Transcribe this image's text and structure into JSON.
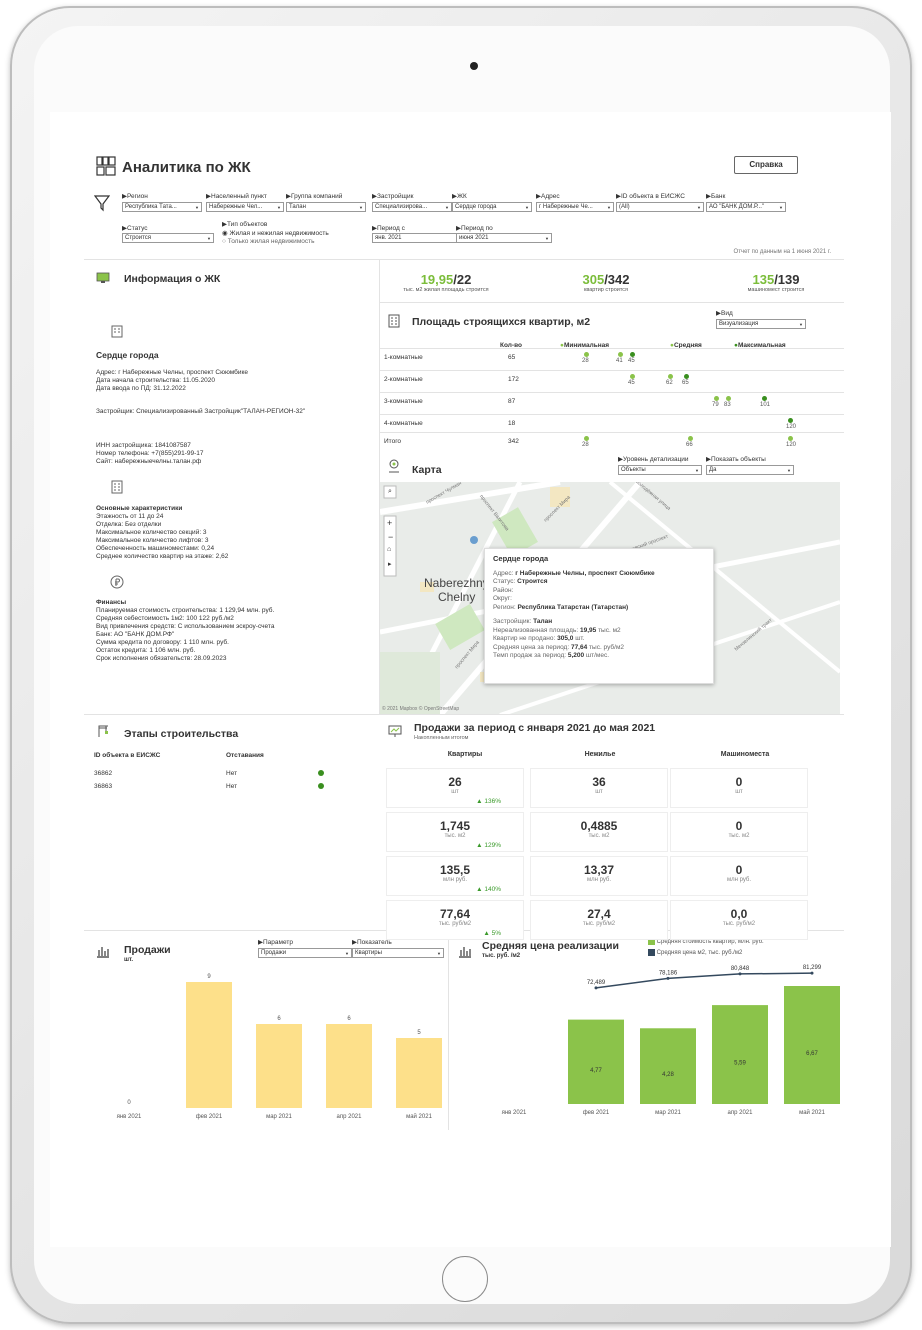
{
  "header": {
    "title": "Аналитика по ЖК",
    "help": "Справка",
    "report_date": "Отчет по данным на 1 июня 2021 г."
  },
  "filters": [
    {
      "label": "Регион",
      "value": "Республика Тата..."
    },
    {
      "label": "Населенный пункт",
      "value": "Набережные Чел..."
    },
    {
      "label": "Группа компаний",
      "value": "Талан"
    },
    {
      "label": "Застройщик",
      "value": "Специализирова..."
    },
    {
      "label": "ЖК",
      "value": "Сердце города"
    },
    {
      "label": "Адрес",
      "value": "г Набережные Че..."
    },
    {
      "label": "ID объекта в ЕИСЖС",
      "value": "(All)"
    },
    {
      "label": "Банк",
      "value": "АО \"БАНК ДОМ.Р...\""
    }
  ],
  "filters2": {
    "status_label": "Статус",
    "status_value": "Строится",
    "type_label": "Тип объектов",
    "type_opt1": "Жилая и нежилая недвижимость",
    "type_opt2": "Только жилая недвижимость",
    "from_label": "Период с",
    "from_value": "янв. 2021",
    "to_label": "Период по",
    "to_value": "июня 2021"
  },
  "info": {
    "title": "Информация о ЖК",
    "name": "Сердце города",
    "lines1": [
      "Адрес: г Набережные Челны, проспект Сююмбике",
      "Дата начала строительства: 11.05.2020",
      "Дата ввода по ПД: 31.12.2022"
    ],
    "developer": "Застройщик: Специализированный Застройщик\"ТАЛАН-РЕГИОН-32\"",
    "lines2": [
      "ИНН застройщика: 1841087587",
      "Номер телефона: +7(855)291-99-17",
      "Сайт: набережныечелны.талан.рф"
    ],
    "main_title": "Основные характеристики",
    "lines3": [
      "Этажность от 11 до 24",
      "Отделка: Без отделки",
      "Максимальное количество секций: 3",
      "Максимальное количество лифтов: 3",
      "Обеспеченность машиноместами: 0,24",
      "Среднее количество квартир на этаже: 2,62"
    ],
    "fin_title": "Финансы",
    "lines4": [
      "Планируемая стоимость строительства: 1 129,94 млн. руб.",
      "Средняя себестоимость 1м2: 100 122 руб./м2",
      "Вид привлечения средств: С использованием эскроу-счета",
      "Банк: АО \"БАНК ДОМ.РФ\"",
      "Сумма кредита по договору: 1 110 млн. руб.",
      "Остаток кредита: 1 106 млн. руб.",
      "Срок исполнения обязательств: 28.09.2023"
    ]
  },
  "kpis": [
    {
      "a": "19,95",
      "b": "/22",
      "sub": "тыс. м2 жилая площадь строится"
    },
    {
      "a": "305",
      "b": "/342",
      "sub": "квартир строится"
    },
    {
      "a": "135",
      "b": "/139",
      "sub": "машиномест строится"
    }
  ],
  "area": {
    "title": "Площадь строящихся квартир, м2",
    "view_label": "Вид",
    "view_value": "Визуализация",
    "cols": [
      "Кол-во",
      "Минимальная",
      "Средняя",
      "Максимальная"
    ],
    "rows": [
      {
        "name": "1-комнатные",
        "count": "65",
        "labels": [
          "28",
          "41",
          "45"
        ]
      },
      {
        "name": "2-комнатные",
        "count": "172",
        "labels": [
          "45",
          "62",
          "65"
        ]
      },
      {
        "name": "3-комнатные",
        "count": "87",
        "labels": [
          "79",
          "83",
          "101"
        ]
      },
      {
        "name": "4-комнатные",
        "count": "18",
        "labels": [
          "120"
        ]
      },
      {
        "name": "Итого",
        "count": "342",
        "labels": [
          "28",
          "66",
          "120"
        ]
      }
    ]
  },
  "map": {
    "title": "Карта",
    "detail_label": "Уровень детализации",
    "detail_value": "Объекты",
    "show_label": "Показать объекты",
    "show_value": "Да",
    "city": "Naberezhnye",
    "city2": "Chelny",
    "copyright": "© 2021 Mapbox © OpenStreetMap",
    "streets": [
      "проспект Чулман",
      "проспект Вахитова",
      "проспект Мира",
      "Московский проспект",
      "проспект Мира",
      "Мензелинский тракт",
      "Молодёжная улица"
    ],
    "tt": {
      "title": "Сердце города",
      "addr_l": "Адрес:",
      "addr": "г Набережные Челны, проспект Сююмбике",
      "status_l": "Статус:",
      "status": "Строится",
      "district_l": "Район:",
      "okrug_l": "Округ:",
      "region_l": "Регион:",
      "region": "Республика Татарстан (Татарстан)",
      "dev_l": "Застройщик:",
      "dev": "Талан",
      "r1": "Нереализованная площадь: ",
      "r1v": "19,95",
      "r1u": " тыс. м2",
      "r2": "Квартир не продано: ",
      "r2v": "305,0",
      "r2u": " шт.",
      "r3": "Средняя цена за период: ",
      "r3v": "77,64",
      "r3u": " тыс. руб/м2",
      "r4": "Темп продаж за период: ",
      "r4v": "5,200",
      "r4u": " шт/мес."
    }
  },
  "stages": {
    "title": "Этапы строительства",
    "col1": "ID объекта в ЕИСЖС",
    "col2": "Отставания",
    "rows": [
      {
        "id": "36862",
        "lag": "Нет"
      },
      {
        "id": "36863",
        "lag": "Нет"
      }
    ]
  },
  "sales": {
    "title": "Продажи за период с января 2021 до мая 2021",
    "sub": "Накопленным итогом",
    "cols": [
      "Квартиры",
      "Нежилье",
      "Машиноместа"
    ],
    "tiles": [
      [
        {
          "v": "26",
          "u": "шт",
          "d": "▲ 136%"
        },
        {
          "v": "36",
          "u": "шт"
        },
        {
          "v": "0",
          "u": "шт"
        }
      ],
      [
        {
          "v": "1,745",
          "u": "тыс. м2",
          "d": "▲ 129%"
        },
        {
          "v": "0,4885",
          "u": "тыс. м2"
        },
        {
          "v": "0",
          "u": "тыс. м2"
        }
      ],
      [
        {
          "v": "135,5",
          "u": "млн руб.",
          "d": "▲ 140%"
        },
        {
          "v": "13,37",
          "u": "млн руб."
        },
        {
          "v": "0",
          "u": "млн руб."
        }
      ],
      [
        {
          "v": "77,64",
          "u": "тыс. руб/м2",
          "d": "▲ 5%"
        },
        {
          "v": "27,4",
          "u": "тыс. руб/м2"
        },
        {
          "v": "0,0",
          "u": "тыс. руб/м2"
        }
      ]
    ]
  },
  "bottom_left": {
    "title": "Продажи",
    "unit": "шт.",
    "param_label": "Параметр",
    "param_value": "Продажи",
    "ind_label": "Показатель",
    "ind_value": "Квартиры"
  },
  "bottom_right": {
    "title": "Средняя цена реализации",
    "unit": "тыс. руб. /м2",
    "legend1": "Средняя стоимость квартир, млн. руб.",
    "legend2": "Средняя цена м2, тыс. руб./м2"
  },
  "colors": {
    "green": "#7bbd3a",
    "yellow": "#fde08a",
    "bar_green": "#8bc34a",
    "line": "#34495e"
  },
  "chart_data": [
    {
      "type": "bar",
      "categories": [
        "янв 2021",
        "фев 2021",
        "мар 2021",
        "апр 2021",
        "май 2021"
      ],
      "values": [
        0,
        9,
        6,
        6,
        5
      ]
    },
    {
      "type": "bar+line",
      "categories": [
        "янв 2021",
        "фев 2021",
        "мар 2021",
        "апр 2021",
        "май 2021"
      ],
      "series": [
        {
          "name": "Средняя стоимость квартир, млн. руб.",
          "values": [
            null,
            4.77,
            4.28,
            5.59,
            6.67
          ],
          "labels": [
            "",
            "4,77",
            "4,28",
            "5,59",
            "6,67"
          ]
        },
        {
          "name": "Средняя цена м2, тыс. руб./м2",
          "values": [
            null,
            72.489,
            78.186,
            80.848,
            81.299
          ],
          "labels": [
            "",
            "72,489",
            "78,186",
            "80,848",
            "81,299"
          ]
        }
      ]
    }
  ]
}
